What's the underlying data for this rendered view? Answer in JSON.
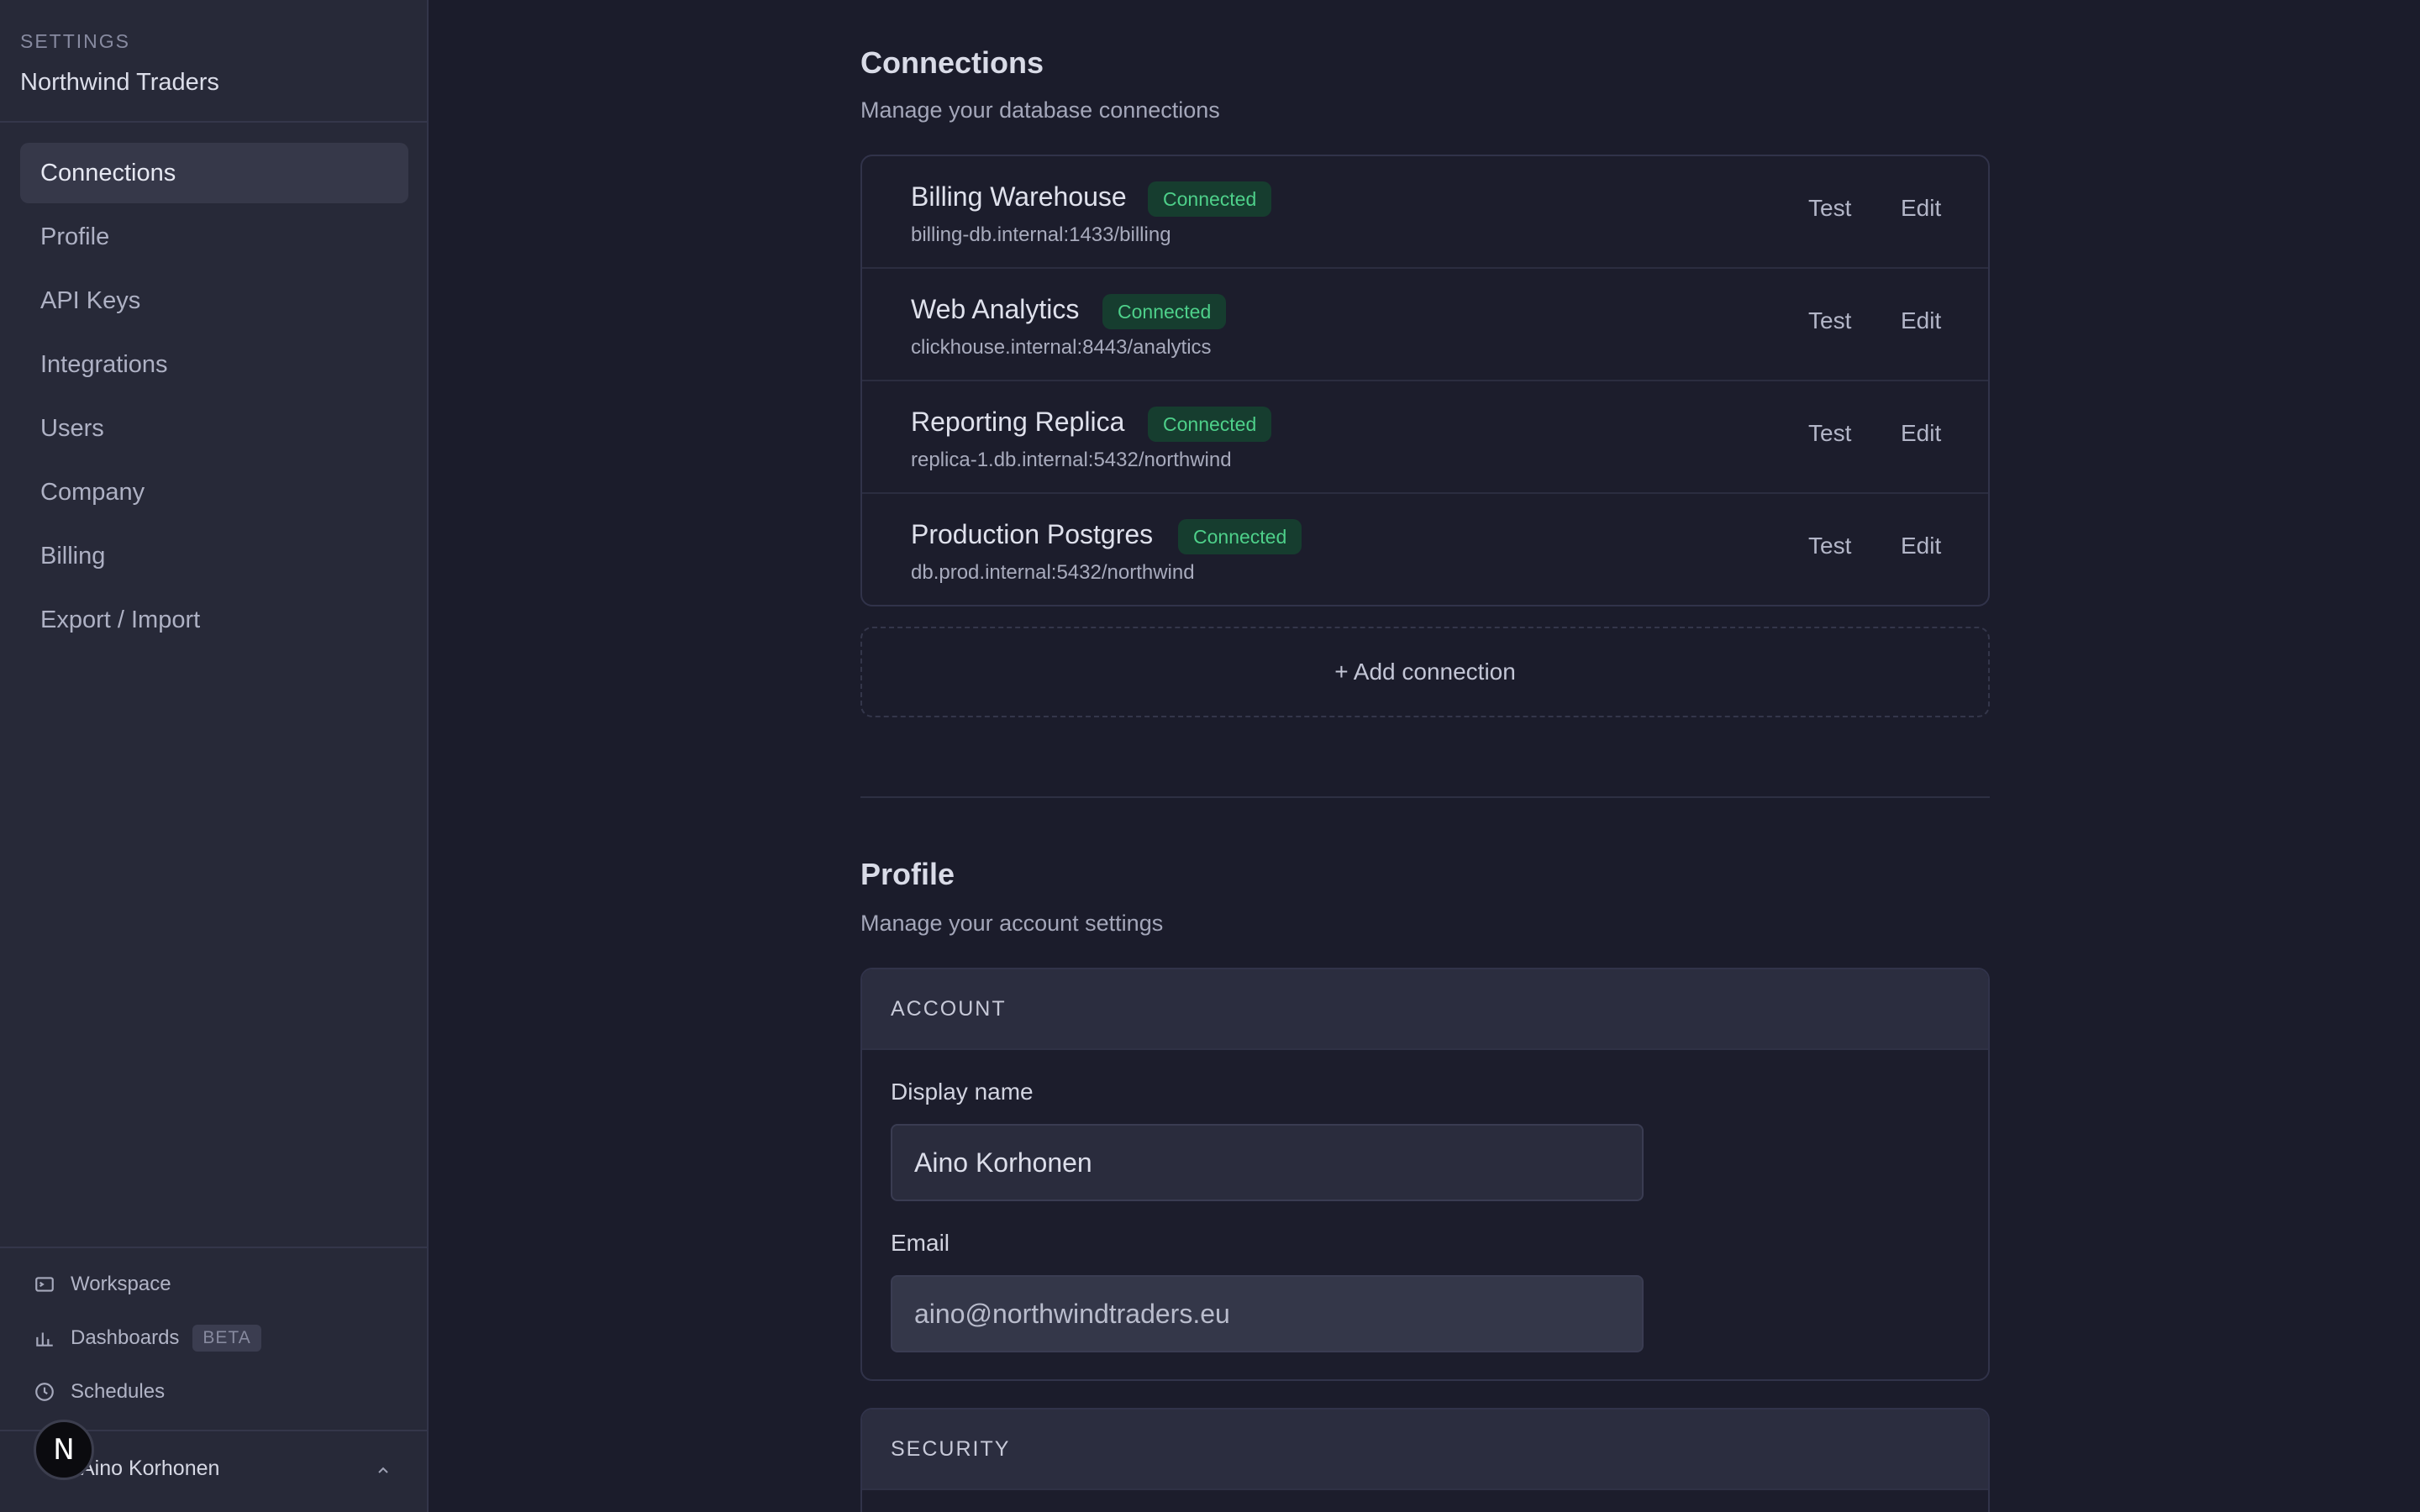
{
  "sidebar": {
    "kicker": "SETTINGS",
    "org": "Northwind Traders",
    "nav": [
      {
        "label": "Connections",
        "active": true
      },
      {
        "label": "Profile"
      },
      {
        "label": "API Keys"
      },
      {
        "label": "Integrations"
      },
      {
        "label": "Users"
      },
      {
        "label": "Company"
      },
      {
        "label": "Billing"
      },
      {
        "label": "Export / Import"
      }
    ],
    "footer": {
      "workspace": "Workspace",
      "dashboards": "Dashboards",
      "beta": "BETA",
      "schedules": "Schedules"
    },
    "user": {
      "name": "Aino Korhonen",
      "avatar_letter": "N"
    }
  },
  "connections": {
    "title": "Connections",
    "subtitle": "Manage your database connections",
    "items": [
      {
        "name": "Billing Warehouse",
        "status": "Connected",
        "address": "billing-db.internal:1433/billing"
      },
      {
        "name": "Web Analytics",
        "status": "Connected",
        "address": "clickhouse.internal:8443/analytics"
      },
      {
        "name": "Reporting Replica",
        "status": "Connected",
        "address": "replica-1.db.internal:5432/northwind"
      },
      {
        "name": "Production Postgres",
        "status": "Connected",
        "address": "db.prod.internal:5432/northwind"
      }
    ],
    "test_label": "Test",
    "edit_label": "Edit",
    "add_label": "+ Add connection"
  },
  "profile": {
    "title": "Profile",
    "subtitle": "Manage your account settings",
    "account_header": "ACCOUNT",
    "display_name_label": "Display name",
    "display_name_value": "Aino Korhonen",
    "email_label": "Email",
    "email_value": "aino@northwindtraders.eu",
    "security_header": "SECURITY"
  },
  "colors": {
    "background": "#1b1c2b",
    "sidebar": "#272938",
    "badge_bg": "#163d2f",
    "badge_text": "#4ed08a"
  }
}
